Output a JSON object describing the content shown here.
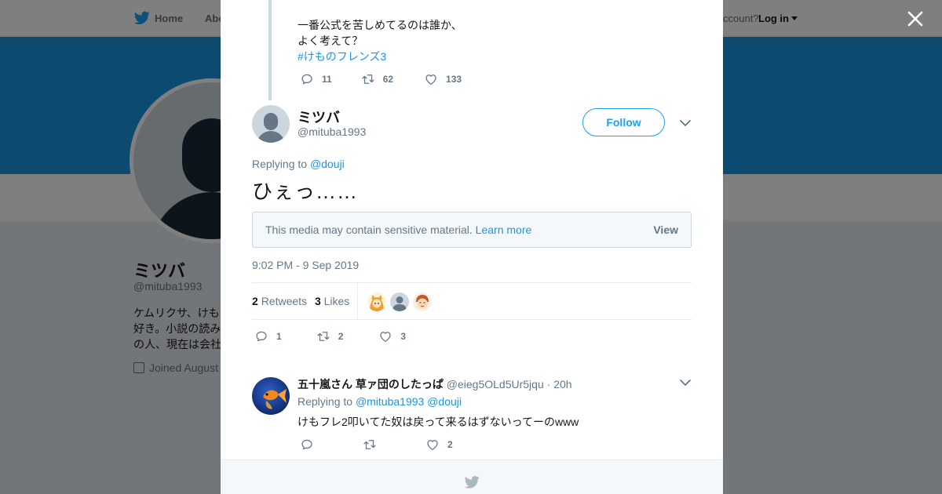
{
  "background": {
    "nav": {
      "home_label": "Home",
      "about_label": "Abo",
      "account_prompt": "ccount?",
      "login_label": "Log in"
    },
    "profile": {
      "name": "ミツバ",
      "handle": "@mituba1993",
      "bio_lines": [
        "ケムリクサ、けも",
        "好き。小説の読み",
        "の人、現在は会社"
      ],
      "joined": "Joined August"
    },
    "colors": {
      "banner": "#1b95e0"
    }
  },
  "modal": {
    "previous_tweet": {
      "lines": [
        "一番公式を苦しめてるのは誰か、",
        "よく考えて？"
      ],
      "hashtag": "#けものフレンズ3",
      "replies": "11",
      "retweets": "62",
      "likes": "133"
    },
    "tweet": {
      "author_name": "ミツバ",
      "author_handle": "@mituba1993",
      "follow_label": "Follow",
      "replying_prefix": "Replying to",
      "replying_mention": "@douji",
      "text": "ひぇっ……",
      "sensitive_message": "This media may contain sensitive material.",
      "learn_more": "Learn more",
      "view_label": "View",
      "timestamp": "9:02 PM - 9 Sep 2019",
      "retweet_count": "2",
      "retweet_label": "Retweets",
      "like_count": "3",
      "like_label": "Likes",
      "action_replies": "1",
      "action_retweets": "2",
      "action_likes": "3"
    },
    "reply": {
      "author_name": "五十嵐さん 草ァ団のしたっぱ",
      "author_handle": "@eieg5OLd5Ur5jqu",
      "time": "· 20h",
      "replying_prefix": "Replying to",
      "mention_1": "@mituba1993",
      "mention_2": "@douji",
      "text": "けもフレ2叩いてた奴は戻って来るはずないってーのwww",
      "likes": "2"
    }
  },
  "icons": {
    "close": "close-icon",
    "reply": "reply-icon",
    "retweet": "retweet-icon",
    "like": "heart-icon",
    "caret": "chevron-down-icon",
    "bird": "twitter-bird-icon"
  },
  "colors": {
    "accent": "#1da1f2",
    "link": "#1b95e0",
    "muted": "#657786",
    "text": "#14171a"
  }
}
